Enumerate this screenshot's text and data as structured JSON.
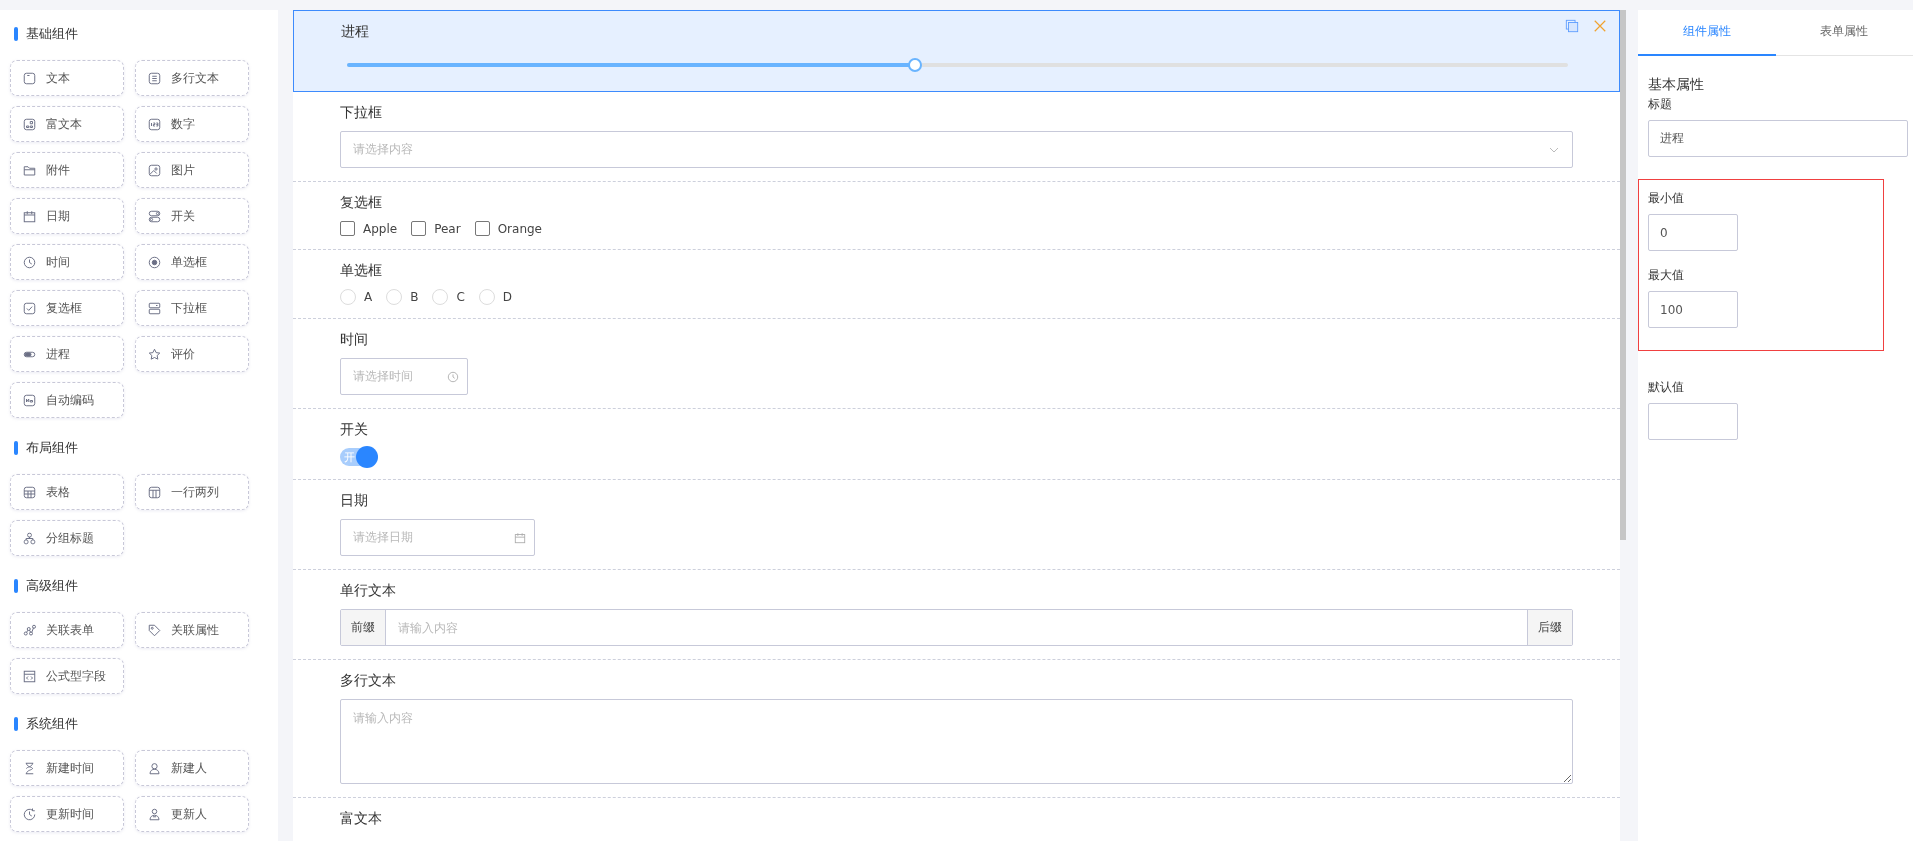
{
  "sidebar": {
    "sections": [
      {
        "title": "基础组件",
        "items": [
          "文本",
          "多行文本",
          "富文本",
          "数字",
          "附件",
          "图片",
          "日期",
          "开关",
          "时间",
          "单选框",
          "复选框",
          "下拉框",
          "进程",
          "评价",
          "自动编码"
        ]
      },
      {
        "title": "布局组件",
        "items": [
          "表格",
          "一行两列",
          "分组标题"
        ]
      },
      {
        "title": "高级组件",
        "items": [
          "关联表单",
          "关联属性",
          "公式型字段"
        ]
      },
      {
        "title": "系统组件",
        "items": [
          "新建时间",
          "新建人",
          "更新时间",
          "更新人"
        ]
      }
    ]
  },
  "canvas": {
    "fields": [
      {
        "kind": "slider",
        "label": "进程",
        "selected": true,
        "level": 0.46
      },
      {
        "kind": "select",
        "label": "下拉框",
        "selected": false,
        "placeholder": "请选择内容"
      },
      {
        "kind": "checkbox",
        "label": "复选框",
        "selected": false,
        "options": [
          {
            "label": "Apple",
            "checked": false
          },
          {
            "label": "Pear",
            "checked": false
          },
          {
            "label": "Orange",
            "checked": false
          }
        ]
      },
      {
        "kind": "radio",
        "label": "单选框",
        "selected": false,
        "options": [
          {
            "label": "A",
            "selected": false
          },
          {
            "label": "B",
            "selected": false
          },
          {
            "label": "C",
            "selected": false
          },
          {
            "label": "D",
            "selected": false
          }
        ]
      },
      {
        "kind": "time",
        "label": "时间",
        "selected": false,
        "placeholder": "请选择时间"
      },
      {
        "kind": "switch",
        "label": "开关",
        "selected": false,
        "on": true,
        "text": "开"
      },
      {
        "kind": "date",
        "label": "日期",
        "selected": false,
        "placeholder": "请选择日期"
      },
      {
        "kind": "input",
        "label": "单行文本",
        "selected": false,
        "prefix": "前缀",
        "placeholder": "请输入内容",
        "suffix": "后缀"
      },
      {
        "kind": "textarea",
        "label": "多行文本",
        "selected": false,
        "placeholder": "请输入内容"
      },
      {
        "kind": "rich",
        "label": "富文本",
        "selected": false
      }
    ]
  },
  "properties": {
    "tabs": [
      {
        "label": "组件属性",
        "selected": true
      },
      {
        "label": "表单属性",
        "selected": false
      }
    ],
    "section_title": "基本属性",
    "groups": [
      {
        "highlighted": false,
        "items": [
          {
            "kind": "text",
            "label": "标题",
            "value": "进程"
          }
        ]
      },
      {
        "highlighted": true,
        "items": [
          {
            "kind": "number",
            "label": "最小值",
            "value": "0"
          },
          {
            "kind": "number",
            "label": "最大值",
            "value": "100"
          }
        ]
      },
      {
        "highlighted": false,
        "items": [
          {
            "kind": "number",
            "label": "默认值",
            "value": ""
          }
        ]
      }
    ]
  }
}
